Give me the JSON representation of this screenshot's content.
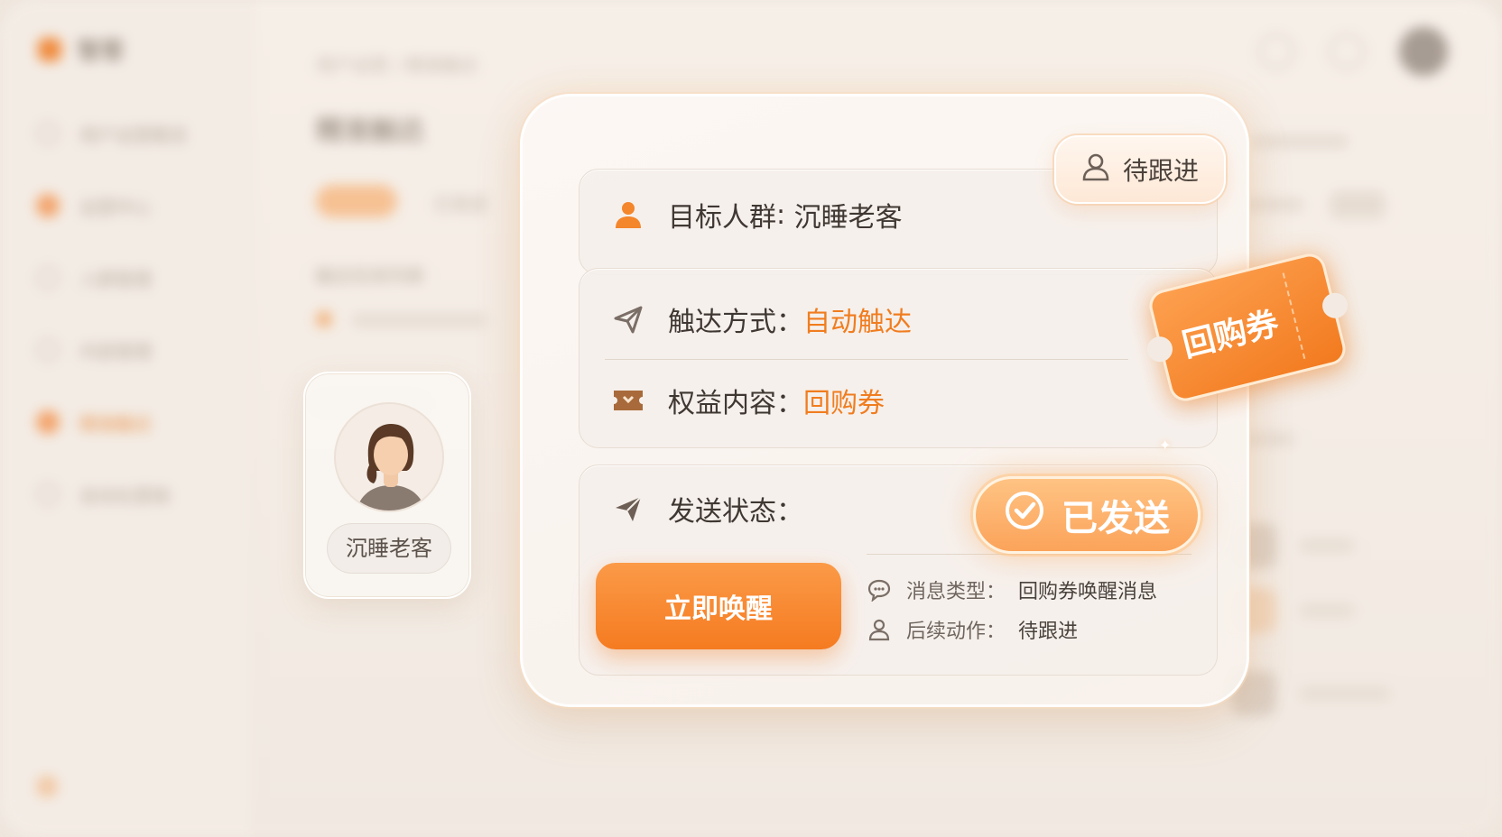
{
  "background_app": {
    "brand": "智客",
    "nav": [
      "用户运营概览",
      "运营中心",
      "人群管理",
      "内容管理",
      "精准触达",
      "自动化营销"
    ],
    "active_nav_index": 4,
    "breadcrumb": "用户运营 / 精准触达",
    "page_title": "精准触达",
    "filter_pill": "全部",
    "filter_tab": "已发送",
    "section_label": "触达任务列表"
  },
  "profile_card": {
    "name": "沉睡老客"
  },
  "card": {
    "target": {
      "label": "目标人群",
      "value": "沉睡老客"
    },
    "channel": {
      "label": "触达方式",
      "value": "自动触达"
    },
    "benefit": {
      "label": "权益内容",
      "value": "回购券"
    },
    "send_status": {
      "label": "发送状态"
    },
    "action_button": "立即唤醒",
    "meta": {
      "message_type": {
        "label": "消息类型",
        "value": "回购券唤醒消息"
      },
      "follow_up": {
        "label": "后续动作",
        "value": "待跟进"
      }
    }
  },
  "pending_tag": "待跟进",
  "sent_badge": "已发送",
  "coupon_label": "回购券",
  "colors": {
    "accent": "#f57b20",
    "accent_light": "#fba35a",
    "text": "#3f3732",
    "background": "#efe7de"
  },
  "icons": {
    "target": "person-icon",
    "channel": "send-outline-icon",
    "benefit": "ticket-icon",
    "status": "send-icon",
    "pending": "person-outline-icon",
    "sent": "check-circle-icon",
    "message": "chat-bubble-icon",
    "follow_up": "person-outline-icon"
  }
}
